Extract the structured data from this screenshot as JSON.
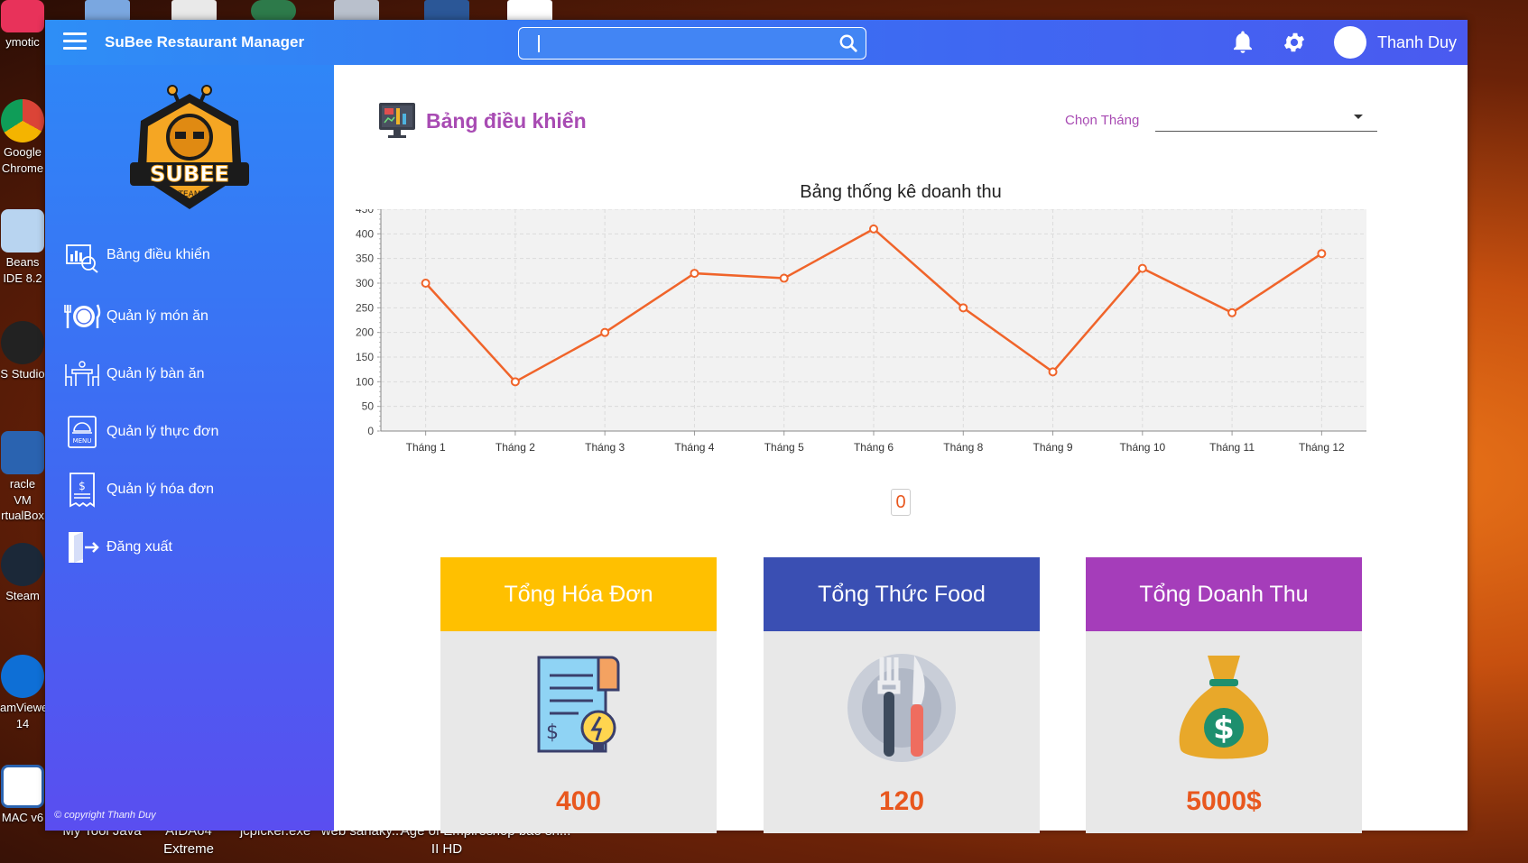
{
  "desktop": {
    "icons": [
      "ymotic",
      "Google Chrome",
      "Beans IDE 8.2",
      "S Studio",
      "racle VM rtualBox",
      "Steam",
      "amViewer 14",
      "MAC v6"
    ],
    "taskbar": [
      "My Tool Java",
      "AIDA64 Extreme",
      "jcpicker.exe",
      "web sanaky...",
      "Age of Empires II HD",
      "hop bao sh..."
    ]
  },
  "app": {
    "title": "SuBee Restaurant Manager",
    "search": {
      "value": "",
      "placeholder": ""
    },
    "user_name": "Thanh Duy"
  },
  "sidebar": {
    "logo_text": "SUBEE",
    "logo_sub": "TEAM",
    "items": [
      {
        "label": "Bảng điều khiển"
      },
      {
        "label": "Quản lý món ăn"
      },
      {
        "label": "Quản lý bàn ăn"
      },
      {
        "label": "Quản lý thực đơn"
      },
      {
        "label": "Quản lý hóa đơn"
      },
      {
        "label": "Đăng xuất"
      }
    ],
    "copyright": "© copyright Thanh Duy"
  },
  "dashboard": {
    "title": "Bảng điều khiển",
    "month_label": "Chọn Tháng",
    "month_value": "",
    "counter": "0"
  },
  "chart_data": {
    "type": "line",
    "title": "Bảng thống kê doanh thu",
    "categories": [
      "Tháng 1",
      "Tháng 2",
      "Tháng 3",
      "Tháng 4",
      "Tháng 5",
      "Tháng 6",
      "Tháng 8",
      "Tháng 9",
      "Tháng 10",
      "Tháng 11",
      "Tháng 12"
    ],
    "values": [
      300,
      100,
      200,
      320,
      310,
      410,
      250,
      120,
      330,
      240,
      360
    ],
    "ylim": [
      0,
      450
    ],
    "yticks": [
      0,
      50,
      100,
      150,
      200,
      250,
      300,
      350,
      400,
      450
    ],
    "grid": true,
    "line_color": "#f0642a"
  },
  "cards": [
    {
      "title": "Tổng Hóa Đơn",
      "value": "400",
      "color": "#ffc000",
      "icon": "receipt-icon"
    },
    {
      "title": "Tổng Thức Food",
      "value": "120",
      "color": "#3a4fb3",
      "icon": "plate-cutlery-icon"
    },
    {
      "title": "Tổng Doanh Thu",
      "value": "5000$",
      "color": "#a53dba",
      "icon": "money-bag-icon"
    }
  ]
}
